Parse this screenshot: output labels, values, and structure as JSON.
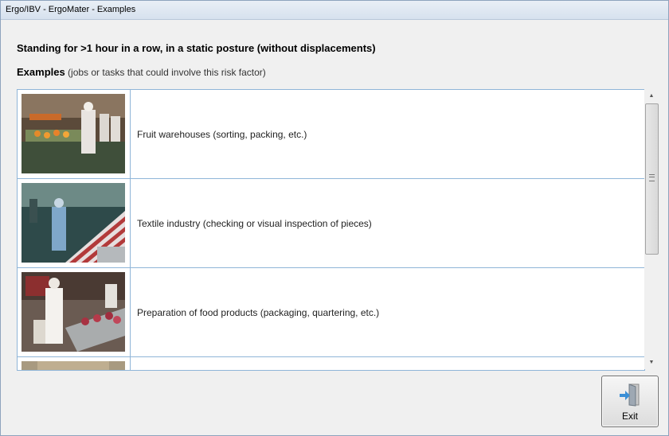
{
  "window": {
    "title": "Ergo/IBV - ErgoMater - Examples"
  },
  "heading": "Standing for >1 hour in a row, in a static posture (without displacements)",
  "subheading": {
    "bold": "Examples",
    "rest": " (jobs or tasks that could involve this risk factor)"
  },
  "examples": [
    {
      "text": "Fruit warehouses (sorting, packing, etc.)",
      "image": "fruit-warehouse-photo"
    },
    {
      "text": "Textile industry (checking or visual inspection of pieces)",
      "image": "textile-industry-photo"
    },
    {
      "text": "Preparation of food products (packaging, quartering, etc.)",
      "image": "food-preparation-photo"
    },
    {
      "text": "",
      "image": "partial-photo"
    }
  ],
  "exit_button": {
    "label": "Exit",
    "icon": "exit-door-icon"
  },
  "colors": {
    "row_border": "#8fb5d8",
    "titlebar": "#dce6f2"
  }
}
